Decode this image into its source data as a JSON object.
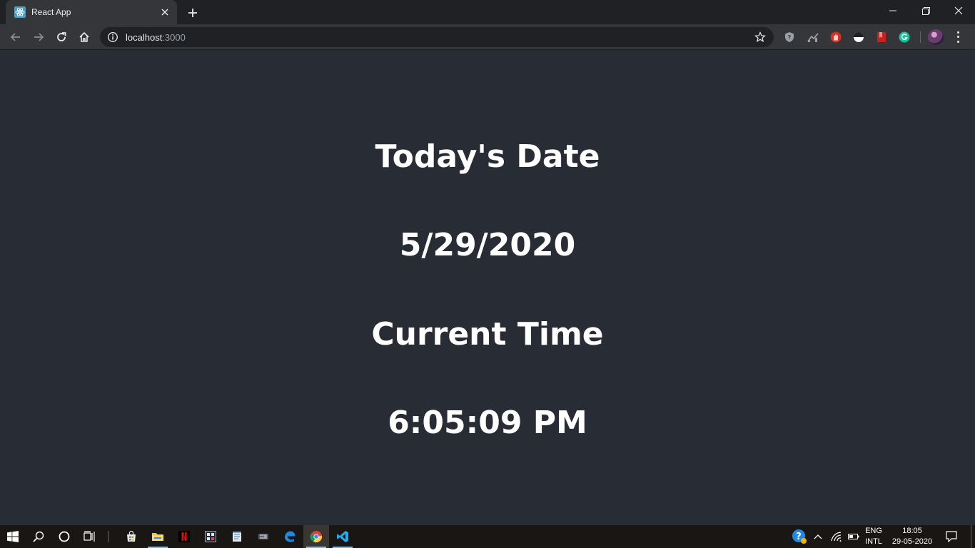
{
  "browser": {
    "tab": {
      "title": "React App",
      "favicon": "react-icon"
    },
    "new_tab_label": "+",
    "address": {
      "host": "localhost",
      "port": ":3000"
    },
    "accent": "#61dafb"
  },
  "page": {
    "background": "#282c34",
    "headings": [
      "Today's Date",
      "5/29/2020",
      "Current Time",
      "6:05:09 PM"
    ]
  },
  "extensions": [
    "shield-icon",
    "chart-icon",
    "stop-hand-icon",
    "eye-icon",
    "bookmark-icon",
    "grammarly-icon"
  ],
  "taskbar": {
    "apps": [
      "windows-start-icon",
      "search-icon",
      "cortana-icon",
      "task-view-icon",
      "store-icon",
      "file-explorer-icon",
      "netflix-icon",
      "photos-icon",
      "notepad-icon",
      "media-icon",
      "edge-icon",
      "chrome-icon",
      "vscode-icon"
    ],
    "tray": {
      "lang_top": "ENG",
      "lang_bottom": "INTL",
      "time": "18:05",
      "date": "29-05-2020"
    }
  }
}
